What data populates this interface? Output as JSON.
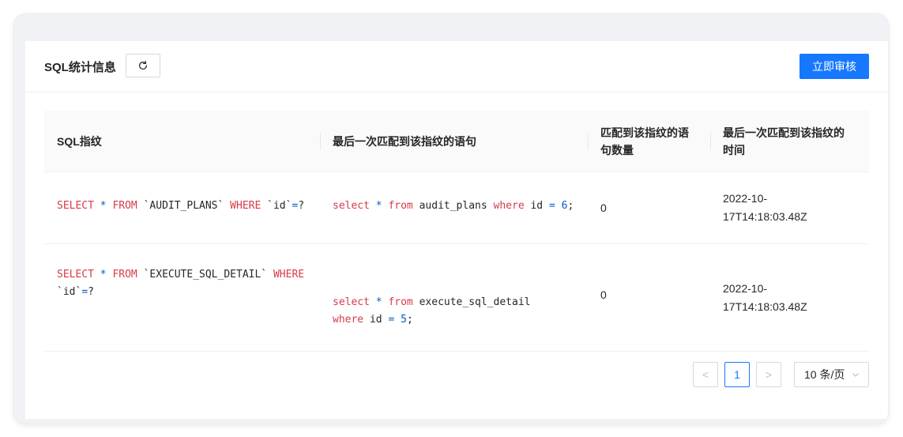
{
  "header": {
    "title": "SQL统计信息",
    "refresh_icon": "refresh-icon",
    "audit_button": "立即审核"
  },
  "table": {
    "columns": [
      "SQL指纹",
      "最后一次匹配到该指纹的语句",
      "匹配到该指纹的语句数量",
      "最后一次匹配到该指纹的时间"
    ],
    "rows": [
      {
        "fingerprint": "SELECT * FROM `AUDIT_PLANS` WHERE `id`=?",
        "statement": "select * from audit_plans where id = 6;",
        "count": "0",
        "time": "2022-10-17T14:18:03.48Z"
      },
      {
        "fingerprint": "SELECT * FROM `EXECUTE_SQL_DETAIL` WHERE `id`=?",
        "statement": "select * from execute_sql_detail where id = 5;",
        "count": "0",
        "time": "2022-10-17T14:18:03.48Z"
      }
    ]
  },
  "pagination": {
    "prev": "<",
    "current": "1",
    "next": ">",
    "page_size": "10 条/页"
  },
  "colors": {
    "primary": "#1677ff",
    "keyword": "#d73a49",
    "operator": "#005cc5"
  }
}
